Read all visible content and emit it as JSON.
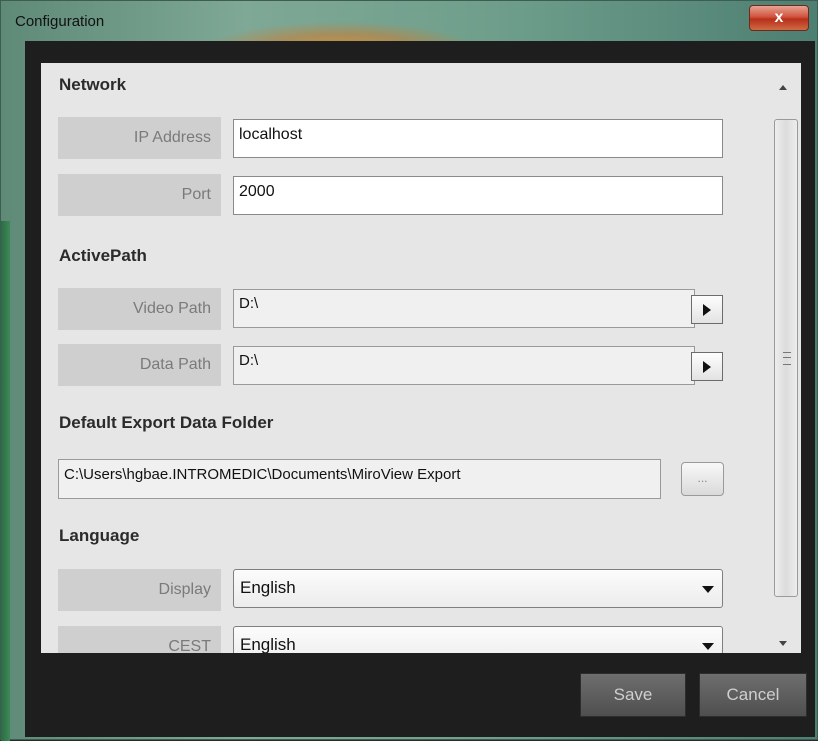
{
  "window": {
    "title": "Configuration",
    "close_glyph": "x"
  },
  "network": {
    "heading": "Network",
    "ip_label": "IP Address",
    "ip_value": "localhost",
    "port_label": "Port",
    "port_value": "2000"
  },
  "active_path": {
    "heading": "ActivePath",
    "video_label": "Video Path",
    "video_value": "D:\\",
    "data_label": "Data Path",
    "data_value": "D:\\"
  },
  "export": {
    "heading": "Default Export Data Folder",
    "folder_value": "C:\\Users\\hgbae.INTROMEDIC\\Documents\\MiroView Export",
    "browse_label": "..."
  },
  "language": {
    "heading": "Language",
    "display_label": "Display",
    "display_value": "English",
    "cest_label": "CEST",
    "cest_value": "English"
  },
  "footer": {
    "save_label": "Save",
    "cancel_label": "Cancel"
  }
}
